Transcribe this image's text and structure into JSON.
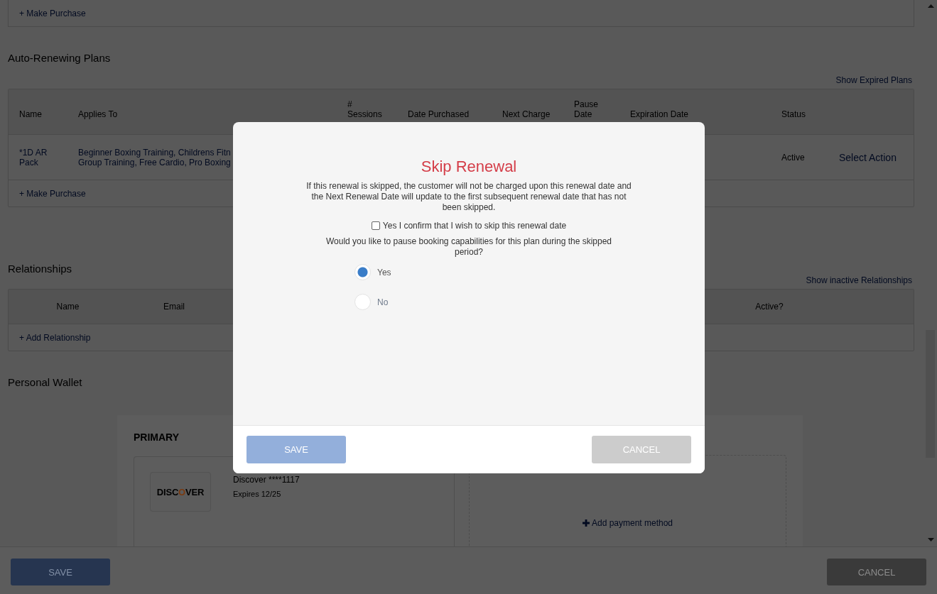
{
  "purchases_panel": {
    "make_purchase_link": "+ Make Purchase"
  },
  "auto_renewing_plans": {
    "title": "Auto-Renewing Plans",
    "show_expired_link": "Show Expired Plans",
    "columns": [
      "Name",
      "Applies To",
      "# Sessions",
      "Date Purchased",
      "Next Charge",
      "Pause Date",
      "Expiration Date",
      "Status"
    ],
    "rows": [
      {
        "name": "*1D AR Pack",
        "applies_to": [
          "Beginner Boxing Training, Childrens Fitn",
          "Group Training, Free Cardio, Pro Boxing"
        ],
        "status": "Active",
        "action": "Select Action"
      }
    ],
    "make_purchase_link": "+ Make Purchase"
  },
  "relationships": {
    "title": "Relationships",
    "show_inactive_link": "Show inactive Relationships",
    "columns": [
      "Name",
      "Email",
      "Active?"
    ],
    "add_link": "+ Add Relationship"
  },
  "personal_wallet": {
    "title": "Personal Wallet",
    "cards": [
      {
        "label": "PRIMARY",
        "logo": "DISCOVER",
        "number": "Discover ****1117",
        "expires": "Expires 12/25"
      }
    ],
    "add_payment_link": "Add payment method"
  },
  "footer_bar": {
    "buttons": [
      {
        "label": "SAVE",
        "kind": "primary"
      },
      {
        "label": "CANCEL",
        "kind": "secondary"
      }
    ]
  },
  "modal": {
    "title": "Skip Renewal",
    "message": "If this renewal is skipped, the customer will not be charged upon this renewal date and the Next Renewal Date will update to the first subsequent renewal date that has not been skipped.",
    "confirm": {
      "label": "Yes I confirm that I wish to skip this renewal date",
      "checked": false
    },
    "question": "Would you like to pause booking capabilities for this plan during the skipped period?",
    "options": [
      {
        "label": "Yes",
        "selected": true
      },
      {
        "label": "No",
        "selected": false
      }
    ],
    "buttons": [
      {
        "label": "SAVE",
        "kind": "primary"
      },
      {
        "label": "CANCEL",
        "kind": "secondary"
      }
    ]
  }
}
